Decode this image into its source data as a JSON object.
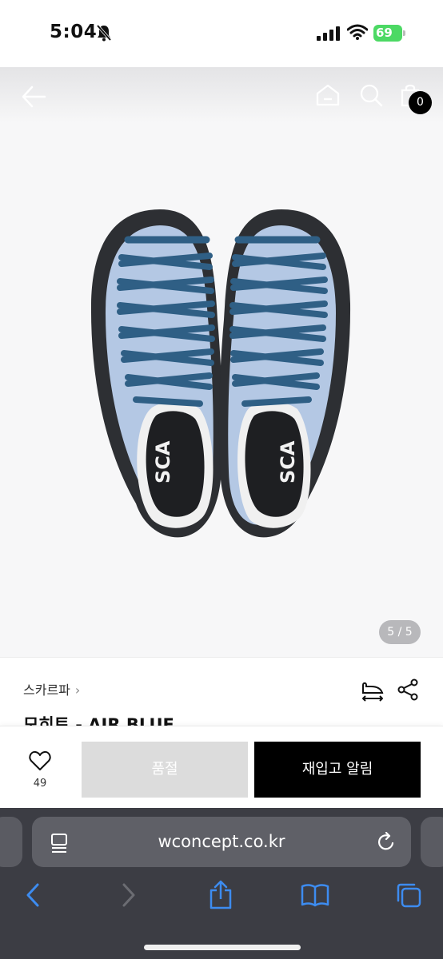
{
  "status_bar": {
    "time": "5:04",
    "battery_level": "69",
    "icons": [
      "bell-slash-icon",
      "signal-icon",
      "wifi-icon",
      "battery-charging-icon"
    ]
  },
  "header": {
    "icons": [
      "back-arrow-icon",
      "home-icon",
      "search-icon",
      "shopping-bag-icon"
    ],
    "cart_count": "0"
  },
  "gallery": {
    "counter": "5 / 5",
    "shoe_logo_text": "SCA",
    "colors": {
      "upper": "#b4c8e4",
      "laces": "#2f5f85",
      "sole": "#2d2f33"
    }
  },
  "product": {
    "brand": "스카르파",
    "brand_chevron": "›",
    "title": "모히토 - AIR BLUE",
    "icons": [
      "size-guide-icon",
      "share-icon"
    ]
  },
  "actions": {
    "like_count": "49",
    "soldout_label": "품절",
    "restock_label": "재입고 알림",
    "icons": [
      "heart-icon"
    ]
  },
  "browser": {
    "url": "wconcept.co.kr",
    "icons": [
      "reader-mode-icon",
      "reload-icon",
      "back-icon",
      "forward-icon",
      "share-icon",
      "bookmarks-icon",
      "tabs-icon"
    ],
    "accent": "#3d8cf0"
  }
}
